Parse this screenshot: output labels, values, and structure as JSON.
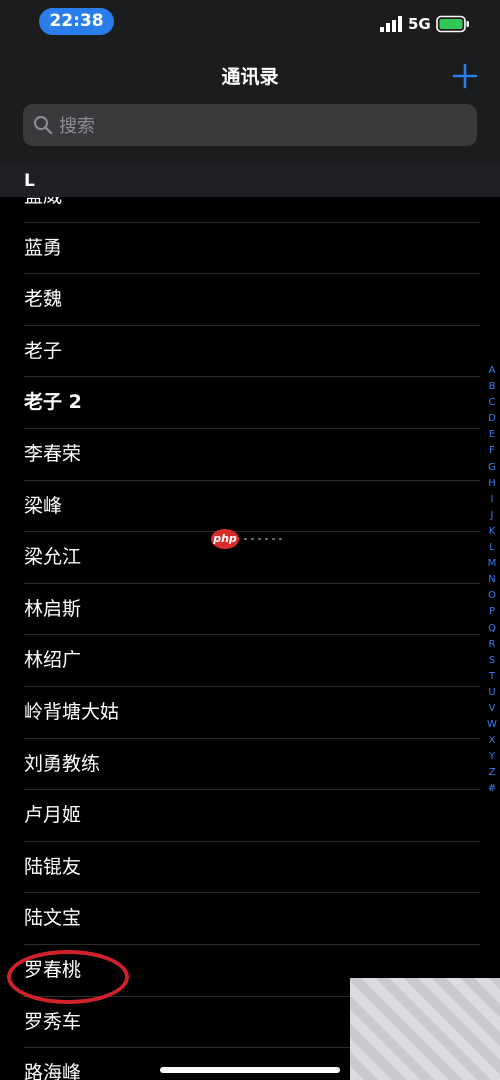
{
  "status_bar": {
    "time": "22:38",
    "network": "5G"
  },
  "nav": {
    "title": "通讯录",
    "add_icon": "plus-icon"
  },
  "search": {
    "placeholder": "搜索",
    "icon": "search-icon"
  },
  "section": {
    "letter": "L"
  },
  "contacts": [
    {
      "name": "蓝威"
    },
    {
      "name": "蓝勇"
    },
    {
      "name": "老魏"
    },
    {
      "name": "老子"
    },
    {
      "name": "老子 2"
    },
    {
      "name": "李春荣"
    },
    {
      "name": "梁峰"
    },
    {
      "name": "梁允江"
    },
    {
      "name": "林启斯"
    },
    {
      "name": "林绍广"
    },
    {
      "name": "岭背塘大姑"
    },
    {
      "name": "刘勇教练"
    },
    {
      "name": "卢月姬"
    },
    {
      "name": "陆锟友"
    },
    {
      "name": "陆文宝"
    },
    {
      "name": "罗春桃"
    },
    {
      "name": "罗秀车"
    },
    {
      "name": "路海峰"
    }
  ],
  "index_letters": [
    "A",
    "B",
    "C",
    "D",
    "E",
    "F",
    "G",
    "H",
    "I",
    "J",
    "K",
    "L",
    "M",
    "N",
    "O",
    "P",
    "Q",
    "R",
    "S",
    "T",
    "U",
    "V",
    "W",
    "X",
    "Y",
    "Z",
    "#"
  ],
  "watermark": {
    "text": "php"
  },
  "colors": {
    "accent": "#2b7de9",
    "index": "#3a7df0",
    "highlight": "#d0212a",
    "battery": "#34c759"
  }
}
